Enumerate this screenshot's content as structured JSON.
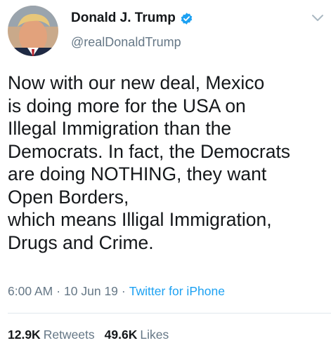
{
  "user": {
    "display_name": "Donald J. Trump",
    "handle": "@realDonaldTrump",
    "verified": true
  },
  "tweet": {
    "lines": [
      "Now with our new deal, Mexico",
      "is doing more for the USA on",
      "Illegal Immigration than the",
      "Democrats. In fact, the Democrats",
      "are doing NOTHING, they want",
      "Open Borders,",
      "which means Illigal Immigration,",
      "Drugs and Crime."
    ],
    "time": "6:00 AM",
    "date": "10 Jun 19",
    "separator": "·",
    "source": "Twitter for iPhone"
  },
  "stats": {
    "retweets_count": "12.9K",
    "retweets_label": "Retweets",
    "likes_count": "49.6K",
    "likes_label": "Likes"
  },
  "icons": {
    "verified": "verified-badge-icon",
    "menu": "chevron-down-icon"
  },
  "colors": {
    "text": "#14171a",
    "secondary": "#657786",
    "accent": "#1da1f2",
    "divider": "#e1e8ed"
  }
}
